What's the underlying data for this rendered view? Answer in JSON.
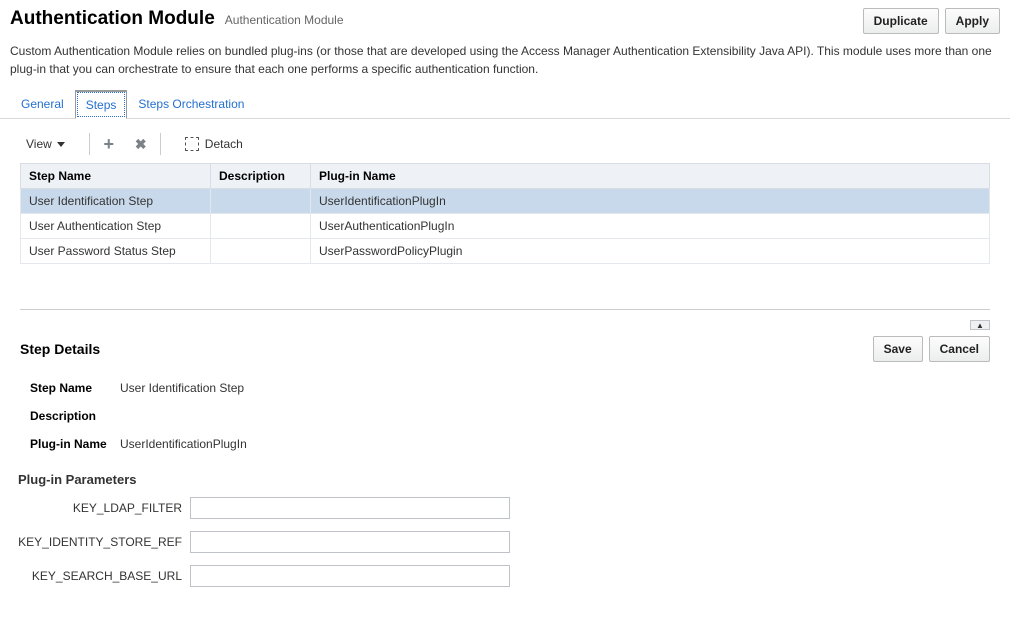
{
  "header": {
    "title": "Authentication Module",
    "subtitle": "Authentication Module",
    "duplicate_label": "Duplicate",
    "apply_label": "Apply"
  },
  "description_text": "Custom Authentication Module relies on bundled plug-ins (or those that are developed using the Access Manager Authentication Extensibility Java API). This module uses more than one plug-in that you can orchestrate to ensure that each one performs a specific authentication function.",
  "tabs": {
    "general": "General",
    "steps": "Steps",
    "orchestration": "Steps Orchestration"
  },
  "toolbar": {
    "view_label": "View",
    "detach_label": "Detach"
  },
  "table": {
    "col_step_name": "Step Name",
    "col_description": "Description",
    "col_plugin_name": "Plug-in Name",
    "rows": [
      {
        "step_name": "User Identification Step",
        "description": "",
        "plugin_name": "UserIdentificationPlugIn"
      },
      {
        "step_name": "User Authentication Step",
        "description": "",
        "plugin_name": "UserAuthenticationPlugIn"
      },
      {
        "step_name": "User Password Status Step",
        "description": "",
        "plugin_name": "UserPasswordPolicyPlugin"
      }
    ]
  },
  "details": {
    "section_title": "Step Details",
    "save_label": "Save",
    "cancel_label": "Cancel",
    "step_name_label": "Step Name",
    "step_name_value": "User Identification Step",
    "description_label": "Description",
    "description_value": "",
    "plugin_name_label": "Plug-in Name",
    "plugin_name_value": "UserIdentificationPlugIn"
  },
  "params": {
    "section_title": "Plug-in Parameters",
    "items": [
      {
        "label": "KEY_LDAP_FILTER",
        "value": ""
      },
      {
        "label": "KEY_IDENTITY_STORE_REF",
        "value": ""
      },
      {
        "label": "KEY_SEARCH_BASE_URL",
        "value": ""
      }
    ]
  },
  "collapse_glyph": "▲"
}
